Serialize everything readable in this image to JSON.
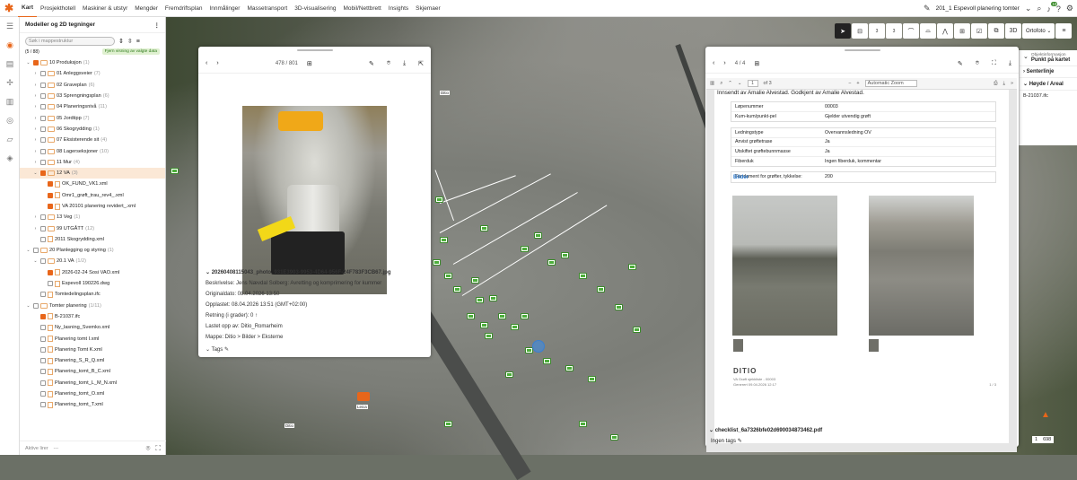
{
  "topbar": {
    "nav": [
      "Kart",
      "Prosjekthotell",
      "Maskiner & utstyr",
      "Mengder",
      "Fremdriftsplan",
      "Innmålinger",
      "Massetransport",
      "3D-visualisering",
      "Mobil/Nettbrett",
      "Insights",
      "Skjemaer"
    ],
    "project": "201_1 Espevoll planering tomter",
    "badge": "10"
  },
  "left_panel": {
    "title": "Modeller og 2D tegninger",
    "search_placeholder": "Søk i mappestruktur",
    "count": "(5 / 88)",
    "filter_chip": "Fjern visning av valgte data",
    "footer_label": "Aktive lirer",
    "footer_value": "---",
    "tree": [
      {
        "ind": 0,
        "arr": "⌄",
        "cb": true,
        "type": "folder",
        "label": "10 Produksjon",
        "count": "(1)"
      },
      {
        "ind": 1,
        "arr": "›",
        "cb": false,
        "type": "folder",
        "label": "01 Anleggsveier",
        "count": "(7)"
      },
      {
        "ind": 1,
        "arr": "›",
        "cb": false,
        "type": "folder",
        "label": "02 Graveplan",
        "count": "(6)"
      },
      {
        "ind": 1,
        "arr": "›",
        "cb": false,
        "type": "folder",
        "label": "03 Sprengningsplan",
        "count": "(6)"
      },
      {
        "ind": 1,
        "arr": "›",
        "cb": false,
        "type": "folder",
        "label": "04 Planeringsnivå",
        "count": "(11)"
      },
      {
        "ind": 1,
        "arr": "›",
        "cb": false,
        "type": "folder",
        "label": "05 Jordtipp",
        "count": "(7)"
      },
      {
        "ind": 1,
        "arr": "›",
        "cb": false,
        "type": "folder",
        "label": "06 Skogrydding",
        "count": "(1)"
      },
      {
        "ind": 1,
        "arr": "›",
        "cb": false,
        "type": "folder",
        "label": "07 Eksisterende sit",
        "count": "(4)"
      },
      {
        "ind": 1,
        "arr": "›",
        "cb": false,
        "type": "folder",
        "label": "08 Lagerseksjoner",
        "count": "(10)"
      },
      {
        "ind": 1,
        "arr": "›",
        "cb": false,
        "type": "folder",
        "label": "11 Mur",
        "count": "(4)"
      },
      {
        "ind": 1,
        "arr": "⌄",
        "cb": true,
        "type": "folder",
        "label": "12 VA",
        "count": "(3)",
        "hl": true
      },
      {
        "ind": 2,
        "arr": "",
        "cb": true,
        "type": "doc",
        "label": "OK_FUND_VK1.xml",
        "count": ""
      },
      {
        "ind": 2,
        "arr": "",
        "cb": true,
        "type": "doc",
        "label": "Omr1_grøft_trau_rev4_.xml",
        "count": ""
      },
      {
        "ind": 2,
        "arr": "",
        "cb": true,
        "type": "doc",
        "label": "VA 20101 planering revidert_.xml",
        "count": ""
      },
      {
        "ind": 1,
        "arr": "›",
        "cb": false,
        "type": "folder",
        "label": "13 Veg",
        "count": "(1)"
      },
      {
        "ind": 1,
        "arr": "›",
        "cb": false,
        "type": "folder",
        "label": "99 UTGÅTT",
        "count": "(12)"
      },
      {
        "ind": 1,
        "arr": "",
        "cb": false,
        "type": "doc",
        "label": "2011 Skogrydding.xml",
        "count": ""
      },
      {
        "ind": 0,
        "arr": "⌄",
        "cb": false,
        "type": "folder",
        "label": "20 Planlegging og styring",
        "count": "(1)"
      },
      {
        "ind": 1,
        "arr": "⌄",
        "cb": false,
        "type": "folder",
        "label": "20.1 VA",
        "count": "(1/2)"
      },
      {
        "ind": 2,
        "arr": "",
        "cb": true,
        "type": "doc",
        "label": "2026-02-24 Sosi VAO.xml",
        "count": ""
      },
      {
        "ind": 2,
        "arr": "",
        "cb": false,
        "type": "doc",
        "label": "Espevoll 190226.dwg",
        "count": ""
      },
      {
        "ind": 1,
        "arr": "",
        "cb": false,
        "type": "doc",
        "label": "Tomtedelingsplan.ifc",
        "count": ""
      },
      {
        "ind": 0,
        "arr": "⌄",
        "cb": false,
        "type": "folder",
        "label": "Tomter planering",
        "count": "(1/11)"
      },
      {
        "ind": 1,
        "arr": "",
        "cb": true,
        "type": "doc",
        "label": "B-21037.ifc",
        "count": ""
      },
      {
        "ind": 1,
        "arr": "",
        "cb": false,
        "type": "doc",
        "label": "Ny_lasning_Svemko.xml",
        "count": ""
      },
      {
        "ind": 1,
        "arr": "",
        "cb": false,
        "type": "doc",
        "label": "Planering tomt I.xml",
        "count": ""
      },
      {
        "ind": 1,
        "arr": "",
        "cb": false,
        "type": "doc",
        "label": "Planering Tomt K.xml",
        "count": ""
      },
      {
        "ind": 1,
        "arr": "",
        "cb": false,
        "type": "doc",
        "label": "Planering_S_R_Q.xml",
        "count": ""
      },
      {
        "ind": 1,
        "arr": "",
        "cb": false,
        "type": "doc",
        "label": "Planering_tomt_B_C.xml",
        "count": ""
      },
      {
        "ind": 1,
        "arr": "",
        "cb": false,
        "type": "doc",
        "label": "Planering_tomt_L_M_N.xml",
        "count": ""
      },
      {
        "ind": 1,
        "arr": "",
        "cb": false,
        "type": "doc",
        "label": "Planering_tomt_O.xml",
        "count": ""
      },
      {
        "ind": 1,
        "arr": "",
        "cb": false,
        "type": "doc",
        "label": "Planering_tomt_T.xml",
        "count": ""
      }
    ]
  },
  "map": {
    "orto_label": "Ortofoto",
    "3d_label": "3D",
    "tool_counts": [
      "3",
      "3"
    ],
    "machine_labels": [
      "Ditio",
      "Leica",
      "Ditio"
    ],
    "scale_label": "1",
    "scale_value": "698"
  },
  "right_panel": {
    "subtitle": "Objektinformasjon",
    "title": "Punkt på kartet",
    "sec1": "Senterlinje",
    "sec2": "Høyde / Areal",
    "value": "B-21037.ifc"
  },
  "photo_popup": {
    "counter": "478 / 801",
    "filename": "20260408115043_photo_931E3903-9953-4D64-956F-24F783F3CB67.jpg",
    "description": "Beskrivelse: Jens Nævdal Solberg: Avretting og komprimering for kummer",
    "original_date": "Originaldato: 08.04.2026 13:50",
    "uploaded": "Opplastet: 08.04.2026 13:51 (GMT+02:00)",
    "direction": "Retning (i grader): 0",
    "uploaded_by": "Lastet opp av: Ditio_Romarheim",
    "folder": "Mappe: Ditio > Bilder > Eksterne",
    "tags": "Tags"
  },
  "pdf_popup": {
    "counter": "4 / 4",
    "page_input": "1",
    "of_pages": "of 3",
    "zoom": "Automatic Zoom",
    "intro": "Innsendt av Amalie Alvestad. Godkjent av Amalie Alvestad.",
    "table1": [
      [
        "Løpenummer",
        "00003"
      ],
      [
        "Kum-kum/punkt-pel",
        "Gjelder utvendig grøft"
      ]
    ],
    "table2": [
      [
        "Ledningstype",
        "Overvannsledning OV"
      ],
      [
        "Anvist grøftetrase",
        "Ja"
      ],
      [
        "Utskiftet grøftebunnmasse",
        "Ja"
      ],
      [
        "Fiberduk",
        "Ingen fiberduk, kommentar"
      ]
    ],
    "table3": [
      [
        "Fundament for grøfter, tykkelse:",
        "200"
      ]
    ],
    "bilder": "Bilder",
    "footer_logo": "DITIO",
    "footer_line1": "VA Grøft sjekkliste - 00003",
    "footer_line2": "Generert 09.04.2026 12:17",
    "footer_page": "1 / 3",
    "filename": "checklist_6a7326bfe02d690034873462.pdf",
    "tags": "Ingen tags"
  }
}
